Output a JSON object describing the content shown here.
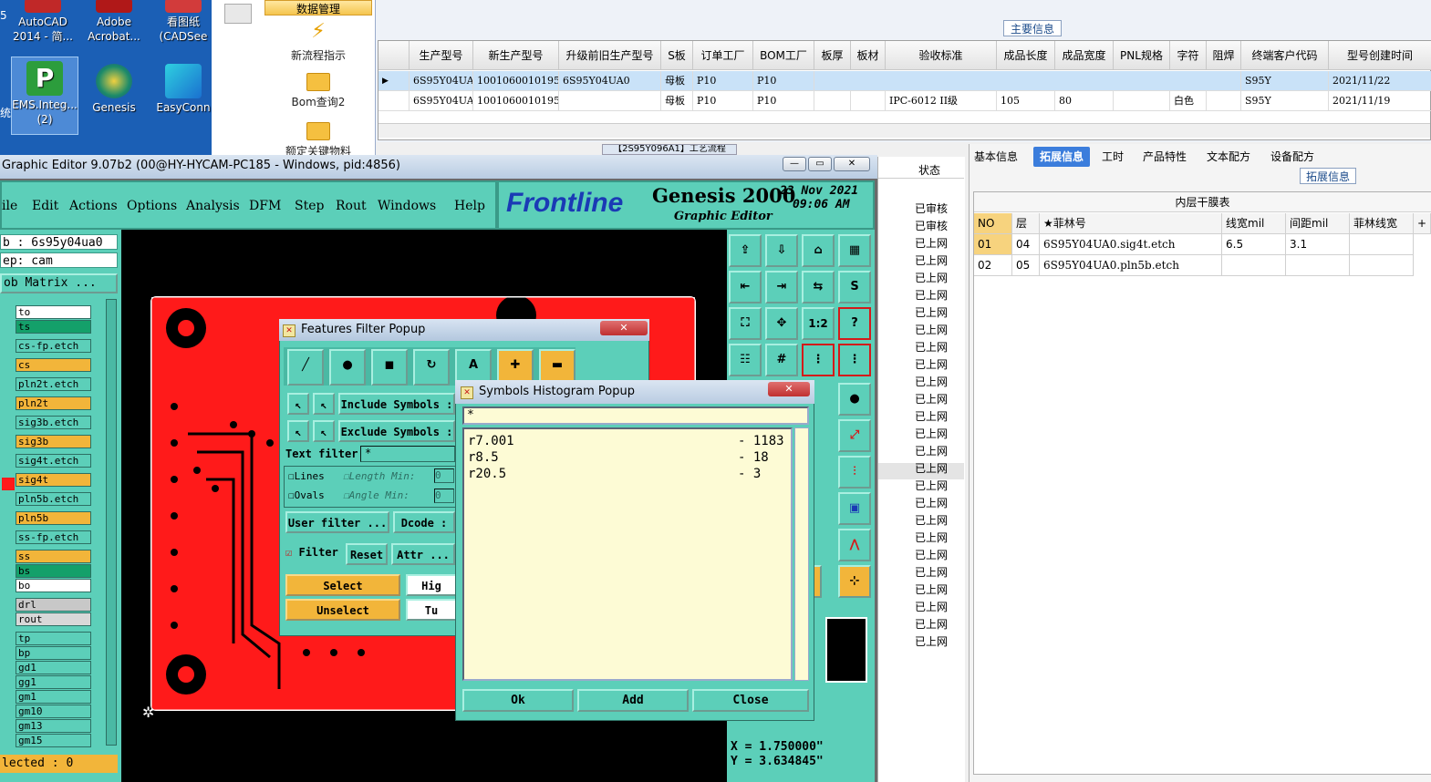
{
  "desktop": {
    "icons": [
      {
        "label": "AutoCAD 2014 - 简..."
      },
      {
        "label": "Adobe Acrobat..."
      },
      {
        "label": "看图纸 (CADSee"
      },
      {
        "label": "EMS.Integ... (2)"
      },
      {
        "label": "Genesis"
      },
      {
        "label": "EasyConn"
      }
    ],
    "edge_left_top": "5",
    "edge_left_mid": "统"
  },
  "mes": {
    "menu_bar": "数据管理",
    "items": [
      "新流程指示",
      "Bom查询2",
      "额定关键物料"
    ],
    "section_title": "主要信息",
    "grid_headers": [
      "生产型号",
      "新生产型号",
      "升级前旧生产型号",
      "S板",
      "订单工厂",
      "BOM工厂",
      "板厚",
      "板材",
      "验收标准",
      "成品长度",
      "成品宽度",
      "PNL规格",
      "字符",
      "阻焊",
      "终端客户代码",
      "型号创建时间"
    ],
    "rows": [
      [
        "6S95Y04UA1",
        "10010600101953",
        "6S95Y04UA0",
        "母板",
        "P10",
        "P10",
        "",
        "",
        "",
        "",
        "",
        "",
        "",
        "",
        "S95Y",
        "2021/11/22"
      ],
      [
        "6S95Y04UA0",
        "10010600101953",
        "",
        "母板",
        "P10",
        "P10",
        "",
        "",
        "IPC-6012 II级",
        "105",
        "80",
        "",
        "白色",
        "",
        "S95Y",
        "2021/11/19"
      ]
    ],
    "status_header": "状态",
    "status_items": [
      "已审核",
      "已审核",
      "已上网",
      "已上网",
      "已上网",
      "已上网",
      "已上网",
      "已上网",
      "已上网",
      "已上网",
      "已上网",
      "已上网",
      "已上网",
      "已上网",
      "已上网",
      "已上网",
      "已上网",
      "已上网",
      "已上网",
      "已上网",
      "已上网",
      "已上网",
      "已上网",
      "已上网",
      "已上网",
      "已上网"
    ],
    "bottom_tab": "【2S95Y096A1】工艺流程"
  },
  "right_panel": {
    "tabs": [
      "基本信息",
      "拓展信息",
      "工时",
      "产品特性",
      "文本配方",
      "设备配方"
    ],
    "active_tab": "拓展信息",
    "section": "拓展信息",
    "table_title": "内层干膜表",
    "headers": [
      "NO",
      "层",
      "★菲林号",
      "线宽mil",
      "间距mil",
      "菲林线宽",
      "+"
    ],
    "rows": [
      [
        "01",
        "04",
        "6S95Y04UA0.sig4t.etch",
        "6.5",
        "3.1",
        ""
      ],
      [
        "02",
        "05",
        "6S95Y04UA0.pln5b.etch",
        "",
        "",
        ""
      ]
    ]
  },
  "genesis": {
    "title": "Graphic Editor 9.07b2 (00@HY-HYCAM-PC185 - Windows, pid:4856)",
    "menu": [
      "ile",
      "Edit",
      "Actions",
      "Options",
      "Analysis",
      "DFM",
      "Step",
      "Rout",
      "Windows",
      "Help"
    ],
    "logo": "Frontline",
    "product": "Genesis 2000",
    "subtitle": "Graphic Editor",
    "date": "23 Nov 2021",
    "time": "09:06 AM",
    "job": "b : 6s95y04ua0",
    "step": "ep: cam",
    "matrix": "ob Matrix ...",
    "layers": [
      {
        "name": "to",
        "color": "#ffffff"
      },
      {
        "name": "ts",
        "color": "#14a06a"
      },
      {
        "name": "cs-fp.etch",
        "color": "#5ccfb9"
      },
      {
        "name": "cs",
        "color": "#f2b53a"
      },
      {
        "name": "pln2t.etch",
        "color": "#5ccfb9"
      },
      {
        "name": "pln2t",
        "color": "#f2b53a"
      },
      {
        "name": "sig3b.etch",
        "color": "#5ccfb9"
      },
      {
        "name": "sig3b",
        "color": "#f2b53a"
      },
      {
        "name": "sig4t.etch",
        "color": "#5ccfb9"
      },
      {
        "name": "sig4t",
        "color": "#f2b53a"
      },
      {
        "name": "pln5b.etch",
        "color": "#5ccfb9"
      },
      {
        "name": "pln5b",
        "color": "#f2b53a"
      },
      {
        "name": "ss-fp.etch",
        "color": "#5ccfb9"
      },
      {
        "name": "ss",
        "color": "#f2b53a"
      },
      {
        "name": "bs",
        "color": "#14a06a"
      },
      {
        "name": "bo",
        "color": "#ffffff"
      },
      {
        "name": "drl",
        "color": "#c8c8c8"
      },
      {
        "name": "rout",
        "color": "#d8d8d8"
      },
      {
        "name": "tp",
        "color": "#5ccfb9"
      },
      {
        "name": "bp",
        "color": "#5ccfb9"
      },
      {
        "name": "gd1",
        "color": "#5ccfb9"
      },
      {
        "name": "gg1",
        "color": "#5ccfb9"
      },
      {
        "name": "gm1",
        "color": "#5ccfb9"
      },
      {
        "name": "gm10",
        "color": "#5ccfb9"
      },
      {
        "name": "gm13",
        "color": "#5ccfb9"
      },
      {
        "name": "gm15",
        "color": "#5ccfb9"
      }
    ],
    "selected": "lected : 0",
    "coord_x": "X = 1.750000\"",
    "coord_y": "Y = 3.634845\""
  },
  "filter_popup": {
    "title": "Features Filter Popup",
    "include_symbols": "Include Symbols :",
    "exclude_symbols": "Exclude Symbols :",
    "text_filter_label": "Text filter",
    "text_filter_value": "*",
    "lines": "Lines",
    "ovals": "Ovals",
    "length": "Length",
    "angle": "Angle",
    "min": "Min:",
    "min_value": "0",
    "user_filter": "User filter ...",
    "dcode": "Dcode :",
    "filter": "Filter",
    "reset": "Reset",
    "attr": "Attr ...",
    "select": "Select",
    "unselect": "Unselect",
    "high": "Hig",
    "turn": "Tu"
  },
  "histogram": {
    "title": "Symbols Histogram Popup",
    "filter": "*",
    "entries": [
      {
        "symbol": "r7.001",
        "count": "- 1183"
      },
      {
        "symbol": "r8.5",
        "count": "- 18"
      },
      {
        "symbol": "r20.5",
        "count": "- 3"
      }
    ],
    "ok": "Ok",
    "add": "Add",
    "close": "Close"
  }
}
